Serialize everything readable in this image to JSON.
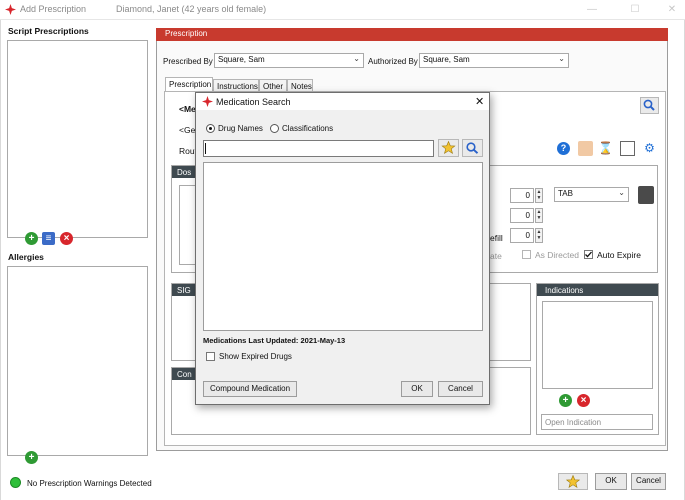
{
  "window": {
    "title": "Add Prescription",
    "patient": "Diamond, Janet (42 years old female)"
  },
  "left": {
    "script_prescriptions_label": "Script Prescriptions",
    "allergies_label": "Allergies",
    "warnings_text": "No Prescription Warnings Detected"
  },
  "prescription": {
    "header": "Prescription",
    "prescribed_by_label": "Prescribed By",
    "prescribed_by_value": "Square, Sam",
    "authorized_by_label": "Authorized By",
    "authorized_by_value": "Square, Sam",
    "tabs": [
      "Prescription",
      "Instructions",
      "Other",
      "Notes"
    ],
    "medication_label_partial": "<Me",
    "generic_label_partial": "<Ge",
    "route_label_partial": "Rout",
    "dose_label_partial": "Dos",
    "sig_label_partial": "SIG",
    "comment_label_partial": "Con",
    "qty_value_1": "0",
    "qty_value_2": "0",
    "refill_value": "0",
    "unit_value": "TAB",
    "refill_label_partial": "efill",
    "date_label_partial": "ate",
    "as_directed_label": "As Directed",
    "auto_expire_label": "Auto Expire",
    "indications_label": "Indications",
    "open_indication_placeholder": "Open Indication"
  },
  "dialog": {
    "title": "Medication Search",
    "radio_drug_names": "Drug Names",
    "radio_classifications": "Classifications",
    "search_value": "",
    "last_updated": "Medications Last Updated: 2021-May-13",
    "show_expired": "Show Expired Drugs",
    "compound_button": "Compound Medication",
    "ok_button": "OK",
    "cancel_button": "Cancel"
  },
  "footer": {
    "ok_button": "OK",
    "cancel_button": "Cancel"
  },
  "colors": {
    "accent_red": "#c83a2e",
    "group_header": "#3f4a50",
    "status_green": "#2fbf3a"
  }
}
